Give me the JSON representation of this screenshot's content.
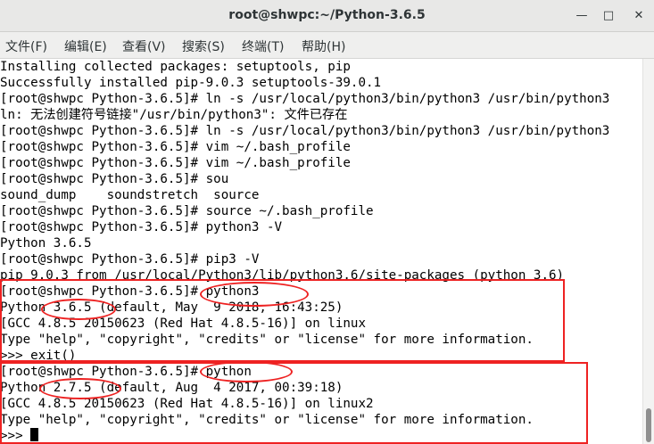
{
  "window": {
    "title": "root@shwpc:~/Python-3.6.5",
    "buttons": {
      "minimize": "—",
      "maximize": "□",
      "close": "✕"
    }
  },
  "menu": [
    "文件(F)",
    "编辑(E)",
    "查看(V)",
    "搜索(S)",
    "终端(T)",
    "帮助(H)"
  ],
  "terminal": {
    "lines": [
      "Installing collected packages: setuptools, pip",
      "Successfully installed pip-9.0.3 setuptools-39.0.1",
      "[root@shwpc Python-3.6.5]# ln -s /usr/local/python3/bin/python3 /usr/bin/python3",
      "ln: 无法创建符号链接\"/usr/bin/python3\": 文件已存在",
      "[root@shwpc Python-3.6.5]# ln -s /usr/local/python3/bin/python3 /usr/bin/python3",
      "[root@shwpc Python-3.6.5]# vim ~/.bash_profile",
      "[root@shwpc Python-3.6.5]# vim ~/.bash_profile",
      "[root@shwpc Python-3.6.5]# sou",
      "sound_dump    soundstretch  source",
      "[root@shwpc Python-3.6.5]# source ~/.bash_profile",
      "[root@shwpc Python-3.6.5]# python3 -V",
      "Python 3.6.5",
      "[root@shwpc Python-3.6.5]# pip3 -V",
      "pip 9.0.3 from /usr/local/Python3/lib/python3.6/site-packages (python 3.6)",
      "[root@shwpc Python-3.6.5]# python3",
      "Python 3.6.5 (default, May  9 2018, 16:43:25)",
      "[GCC 4.8.5 20150623 (Red Hat 4.8.5-16)] on linux",
      "Type \"help\", \"copyright\", \"credits\" or \"license\" for more information.",
      ">>> exit()",
      "[root@shwpc Python-3.6.5]# python",
      "Python 2.7.5 (default, Aug  4 2017, 00:39:18)",
      "[GCC 4.8.5 20150623 (Red Hat 4.8.5-16)] on linux2",
      "Type \"help\", \"copyright\", \"credits\" or \"license\" for more information."
    ],
    "prompt": ">>> "
  },
  "colors": {
    "annotation": "#e22222",
    "terminal_bg": "#ffffff",
    "text": "#000000"
  }
}
